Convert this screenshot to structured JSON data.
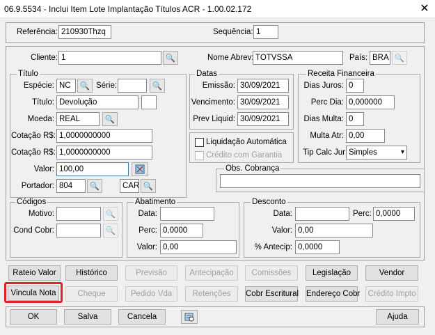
{
  "window": {
    "title": "06.9.5534 - Inclui Item Lote Implantação Títulos ACR - 1.00.02.172"
  },
  "top": {
    "referencia_label": "Referência:",
    "referencia_value": "210930Thzq",
    "sequencia_label": "Sequência:",
    "sequencia_value": "1"
  },
  "cliente": {
    "cliente_label": "Cliente:",
    "cliente_value": "1",
    "nome_abrev_label": "Nome Abrev:",
    "nome_abrev_value": "TOTVSSA",
    "pais_label": "País:",
    "pais_value": "BRA"
  },
  "titulo": {
    "group_label": "Título",
    "especie_label": "Espécie:",
    "especie_value": "NC",
    "serie_label": "Série:",
    "serie_value": "",
    "titulo_label": "Título:",
    "titulo_value": "Devolução",
    "parcela_value": "",
    "moeda_label": "Moeda:",
    "moeda_value": "REAL",
    "cotacao1_label": "Cotação R$:",
    "cotacao1_value": "1,0000000000",
    "cotacao2_label": "Cotação R$:",
    "cotacao2_value": "1,0000000000",
    "valor_label": "Valor:",
    "valor_value": "100,00",
    "portador_label": "Portador:",
    "portador_value": "804",
    "carteira_value": "CAR"
  },
  "datas": {
    "group_label": "Datas",
    "emissao_label": "Emissão:",
    "emissao_value": "30/09/2021",
    "vencimento_label": "Vencimento:",
    "vencimento_value": "30/09/2021",
    "prev_liquid_label": "Prev Liquid:",
    "prev_liquid_value": "30/09/2021",
    "liquidacao_label": "Liquidação Automática",
    "credito_garantia_label": "Crédito com Garantia"
  },
  "receita": {
    "group_label": "Receita Financeira",
    "dias_juros_label": "Dias Juros:",
    "dias_juros_value": "0",
    "perc_dia_label": "Perc Dia:",
    "perc_dia_value": "0,000000",
    "dias_multa_label": "Dias Multa:",
    "dias_multa_value": "0",
    "multa_atr_label": "Multa Atr:",
    "multa_atr_value": "0,00",
    "tip_calc_label": "Tip Calc Jur:",
    "tip_calc_value": "Simples"
  },
  "obs": {
    "group_label": "Obs. Cobrança",
    "value": ""
  },
  "codigos": {
    "group_label": "Códigos",
    "motivo_label": "Motivo:",
    "motivo_value": "",
    "cond_cobr_label": "Cond Cobr:",
    "cond_cobr_value": ""
  },
  "abatimento": {
    "group_label": "Abatimento",
    "data_label": "Data:",
    "data_value": "",
    "perc_label": "Perc:",
    "perc_value": "0,0000",
    "valor_label": "Valor:",
    "valor_value": "0,00"
  },
  "desconto": {
    "group_label": "Desconto",
    "data_label": "Data:",
    "data_value": "",
    "perc_label": "Perc:",
    "perc_value": "0,0000",
    "valor_label": "Valor:",
    "valor_value": "0,00",
    "antecip_label": "% Antecip:",
    "antecip_value": "0,0000"
  },
  "buttons_row1": [
    "Rateio Valor",
    "Histórico",
    "Previsão",
    "Antecipação",
    "Comissões",
    "Legislação",
    "Vendor"
  ],
  "buttons_row2": [
    "Vincula Nota",
    "Cheque",
    "Pedido Vda",
    "Retenções",
    "Cobr Escritural",
    "Endereço Cobr",
    "Crédito Impto"
  ],
  "footer": {
    "ok": "OK",
    "salva": "Salva",
    "cancela": "Cancela",
    "ajuda": "Ajuda"
  },
  "colors": {
    "highlight": "#e32227",
    "disabled_text": "#a0a0a0"
  }
}
